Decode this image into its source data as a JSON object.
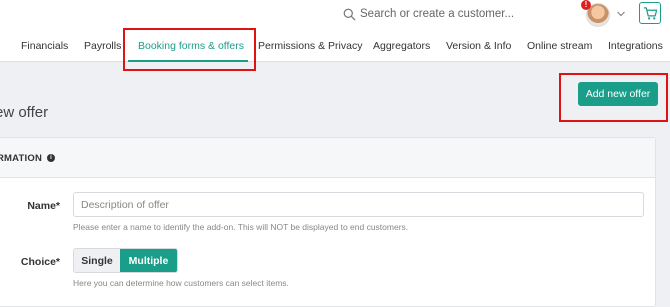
{
  "header": {
    "search_placeholder": "Search or create a customer...",
    "notification_count": "!"
  },
  "tabs": [
    {
      "label": "Financials",
      "active": false
    },
    {
      "label": "Payrolls",
      "active": false
    },
    {
      "label": "Booking forms & offers",
      "active": true
    },
    {
      "label": "Permissions & Privacy",
      "active": false
    },
    {
      "label": "Aggregators",
      "active": false
    },
    {
      "label": "Version & Info",
      "active": false
    },
    {
      "label": "Online stream",
      "active": false
    },
    {
      "label": "Integrations",
      "active": false
    }
  ],
  "page": {
    "title": "ew offer",
    "add_button_label": "Add new offer"
  },
  "panel": {
    "title": "RMATION",
    "info_glyph": "i"
  },
  "form": {
    "name_label": "Name*",
    "name_value": "",
    "name_placeholder": "Description of offer",
    "name_help": "Please enter a name to identify the add-on. This will NOT be displayed to end customers.",
    "choice_label": "Choice*",
    "choice_options": [
      "Single",
      "Multiple"
    ],
    "choice_selected": "Multiple",
    "choice_help": "Here you can determine how customers can select items."
  },
  "colors": {
    "accent": "#1a9e8a",
    "highlight": "#e01212",
    "notification": "#e02020"
  }
}
